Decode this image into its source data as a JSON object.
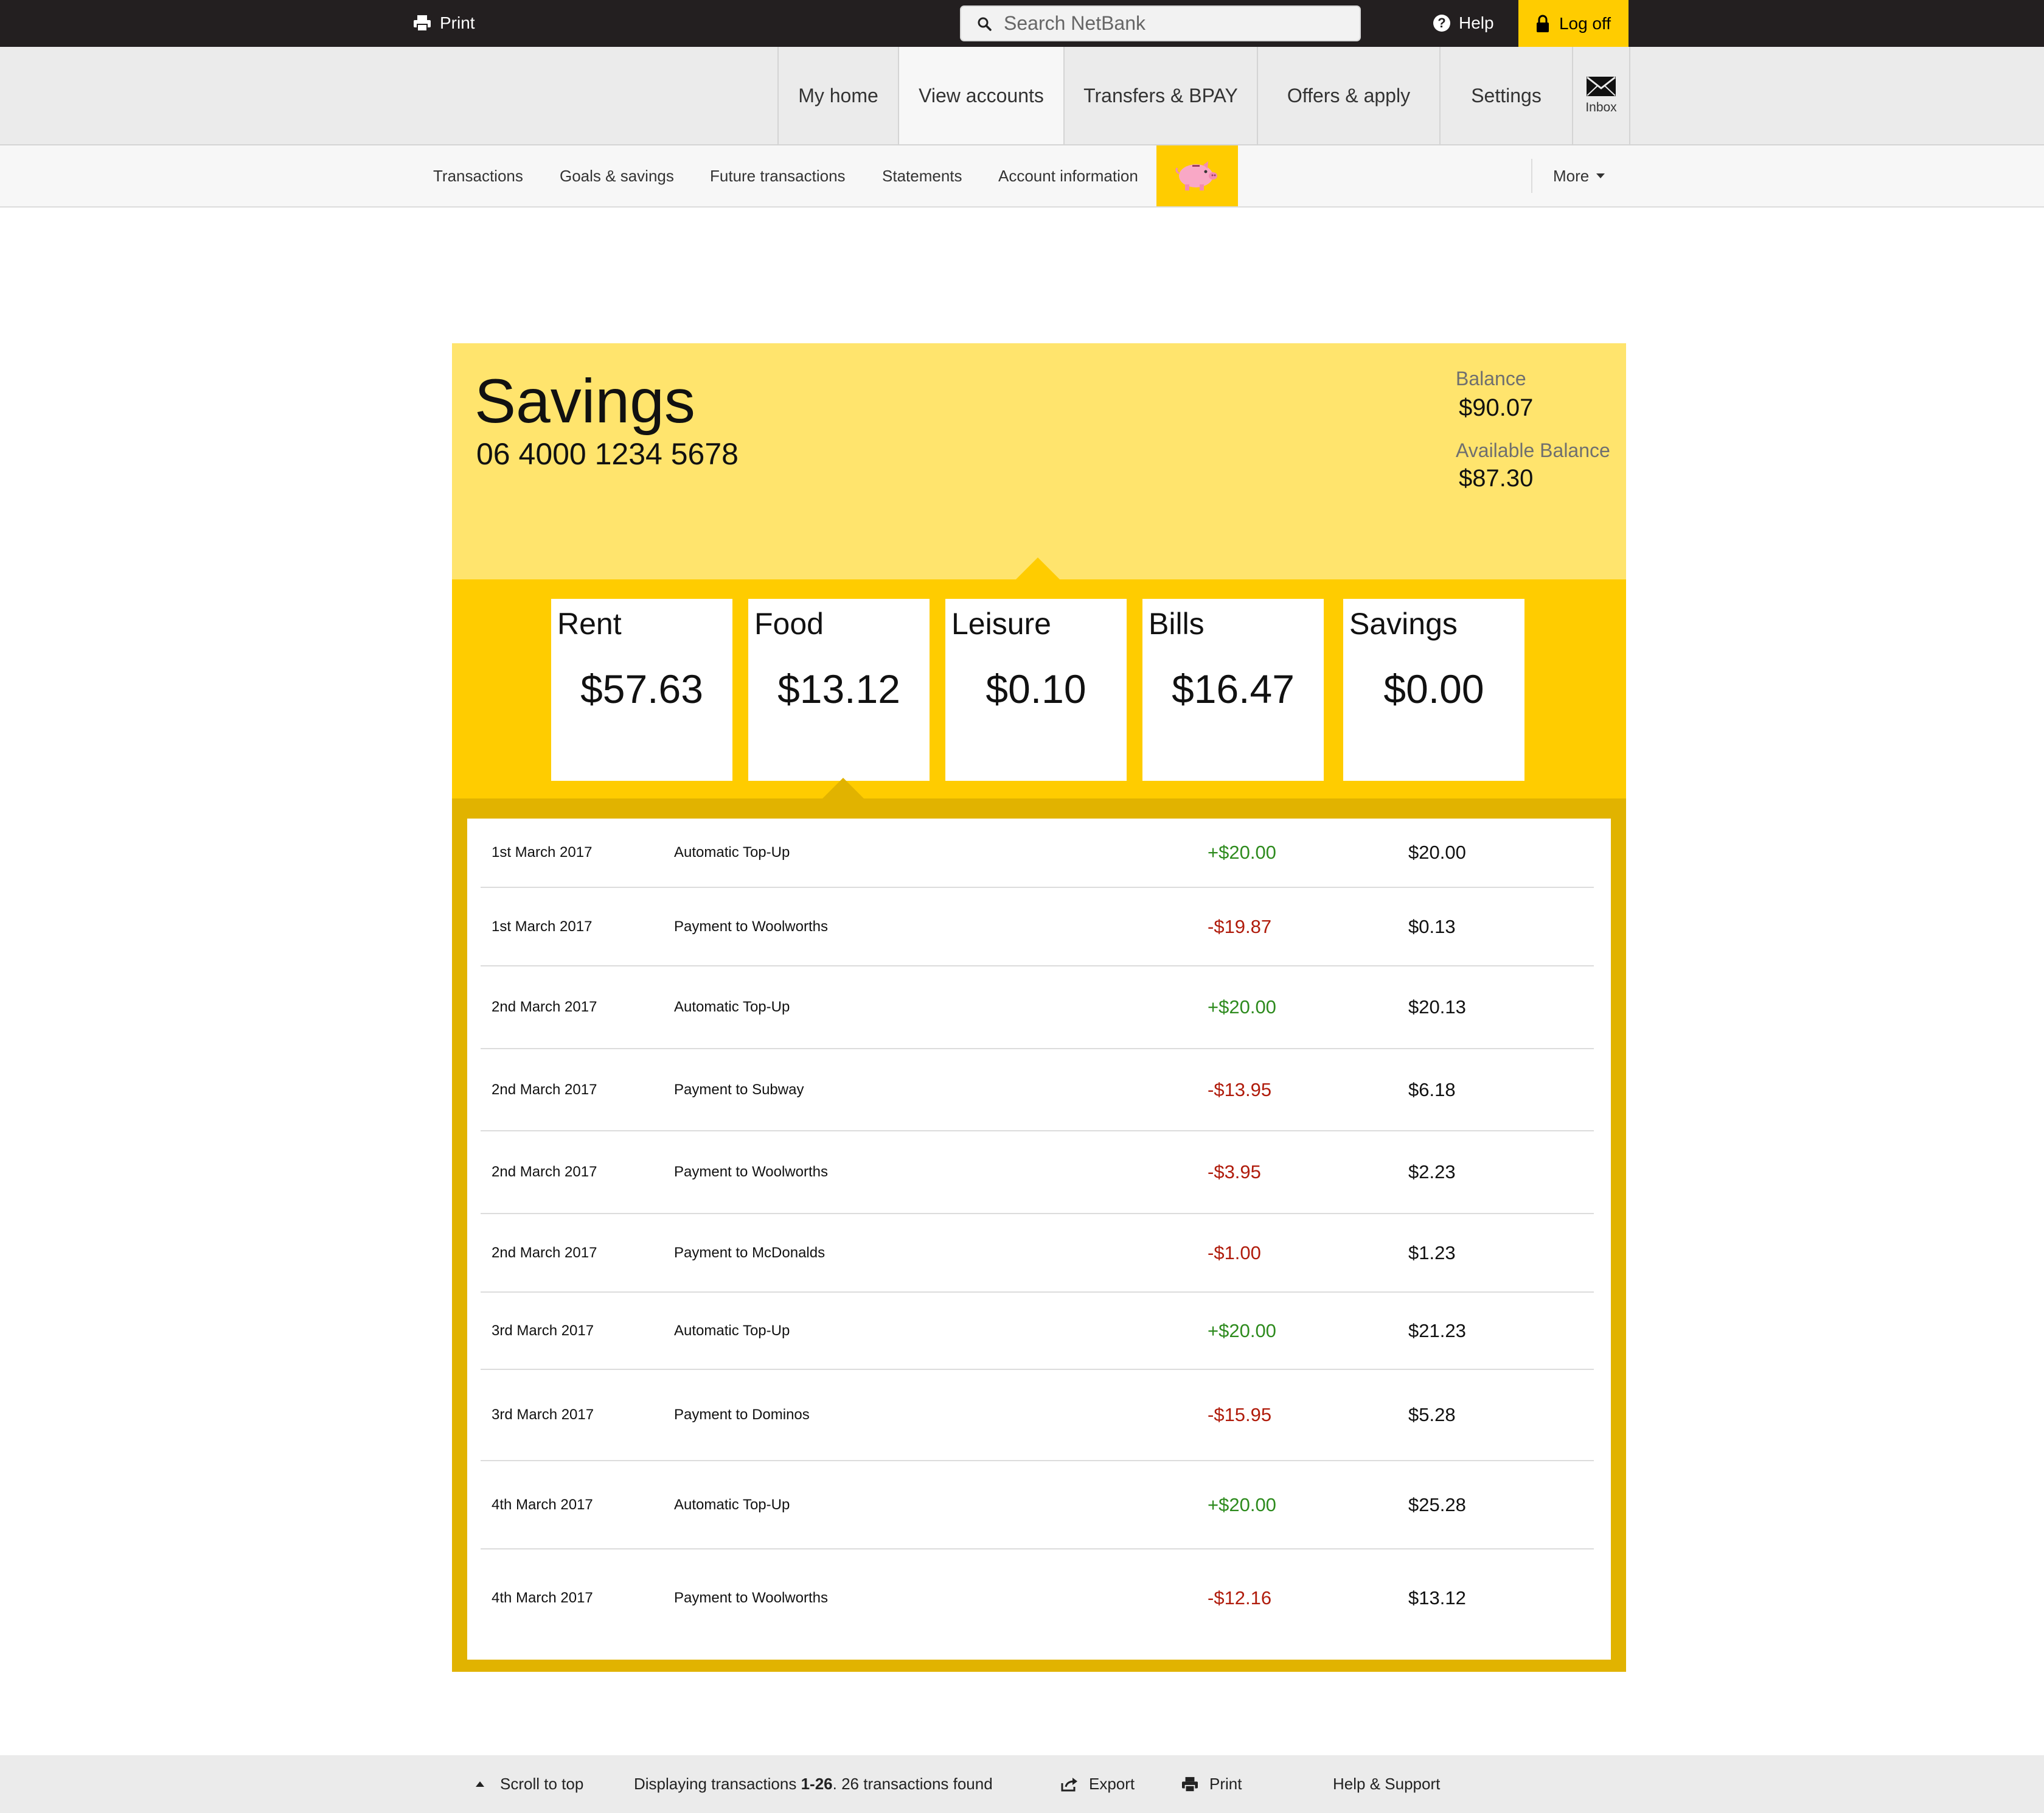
{
  "topbar": {
    "print_label": "Print",
    "search_placeholder": "Search NetBank",
    "help_label": "Help",
    "logoff_label": "Log off"
  },
  "mainnav": {
    "items": [
      {
        "label": "My home"
      },
      {
        "label": "View accounts"
      },
      {
        "label": "Transfers & BPAY"
      },
      {
        "label": "Offers & apply"
      },
      {
        "label": "Settings"
      }
    ],
    "inbox_label": "Inbox"
  },
  "subnav": {
    "items": [
      {
        "label": "Transactions"
      },
      {
        "label": "Goals & savings"
      },
      {
        "label": "Future transactions"
      },
      {
        "label": "Statements"
      },
      {
        "label": "Account information"
      }
    ],
    "more_label": "More",
    "pig_icon": "piggy-bank-icon"
  },
  "account": {
    "name": "Savings",
    "number": "06 4000 1234 5678",
    "balance_label": "Balance",
    "balance": "$90.07",
    "available_label": "Available Balance",
    "available": "$87.30"
  },
  "categories": [
    {
      "name": "Rent",
      "amount": "$57.63"
    },
    {
      "name": "Food",
      "amount": "$13.12"
    },
    {
      "name": "Leisure",
      "amount": "$0.10"
    },
    {
      "name": "Bills",
      "amount": "$16.47"
    },
    {
      "name": "Savings",
      "amount": "$0.00"
    }
  ],
  "transactions": [
    {
      "date": "1st March 2017",
      "description": "Automatic Top-Up",
      "amount": "+$20.00",
      "balance": "$20.00"
    },
    {
      "date": "1st March 2017",
      "description": "Payment to Woolworths",
      "amount": "-$19.87",
      "balance": "$0.13"
    },
    {
      "date": "2nd March 2017",
      "description": "Automatic Top-Up",
      "amount": "+$20.00",
      "balance": "$20.13"
    },
    {
      "date": "2nd March 2017",
      "description": "Payment to Subway",
      "amount": "-$13.95",
      "balance": "$6.18"
    },
    {
      "date": "2nd March 2017",
      "description": "Payment to Woolworths",
      "amount": "-$3.95",
      "balance": "$2.23"
    },
    {
      "date": "2nd March 2017",
      "description": "Payment to McDonalds",
      "amount": "-$1.00",
      "balance": "$1.23"
    },
    {
      "date": "3rd March 2017",
      "description": "Automatic Top-Up",
      "amount": "+$20.00",
      "balance": "$21.23"
    },
    {
      "date": "3rd March 2017",
      "description": "Payment to Dominos",
      "amount": "-$15.95",
      "balance": "$5.28"
    },
    {
      "date": "4th March 2017",
      "description": "Automatic Top-Up",
      "amount": "+$20.00",
      "balance": "$25.28"
    },
    {
      "date": "4th March 2017",
      "description": "Payment to Woolworths",
      "amount": "-$12.16",
      "balance": "$13.12"
    }
  ],
  "footer": {
    "scroll_label": "Scroll to top",
    "display_prefix": "Displaying transactions ",
    "display_range": "1-26",
    "display_suffix": ". 26 transactions found",
    "export_label": "Export",
    "print_label": "Print",
    "help_label": "Help & Support"
  },
  "colors": {
    "brand_yellow": "#ffcc00",
    "header_yellow": "#ffe46d",
    "frame_gold": "#e1b300",
    "credit_green": "#2e8b1e",
    "debit_red": "#b01c0c",
    "topbar_dark": "#231f20"
  }
}
